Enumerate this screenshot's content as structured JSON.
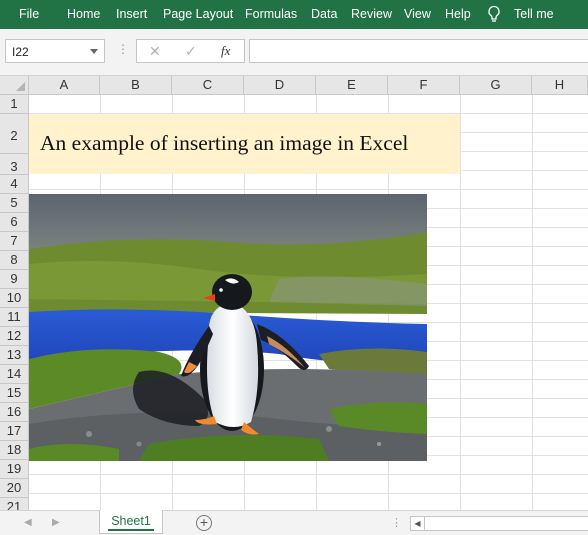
{
  "ribbon": {
    "tabs": [
      "File",
      "Home",
      "Insert",
      "Page Layout",
      "Formulas",
      "Data",
      "Review",
      "View",
      "Help"
    ],
    "tell_me": "Tell me",
    "color": "#217346"
  },
  "formula_bar": {
    "name_box": "I22",
    "cancel_icon": "close-icon",
    "enter_icon": "check-icon",
    "fx_label": "fx",
    "formula_value": ""
  },
  "grid": {
    "columns": [
      "A",
      "B",
      "C",
      "D",
      "E",
      "F",
      "G",
      "H"
    ],
    "rows": [
      "1",
      "2",
      "3",
      "4",
      "5",
      "6",
      "7",
      "8",
      "9",
      "10",
      "11",
      "12",
      "13",
      "14",
      "15",
      "16",
      "17",
      "18",
      "19",
      "20",
      "21"
    ]
  },
  "title_cell": {
    "text": "An example of inserting an image in Excel",
    "fill_color": "#fff2cc"
  },
  "picture": {
    "subject": "gentoo penguin"
  },
  "sheets": {
    "tabs": [
      "Sheet1"
    ],
    "active": "Sheet1",
    "add_icon": "plus-circle-icon"
  }
}
